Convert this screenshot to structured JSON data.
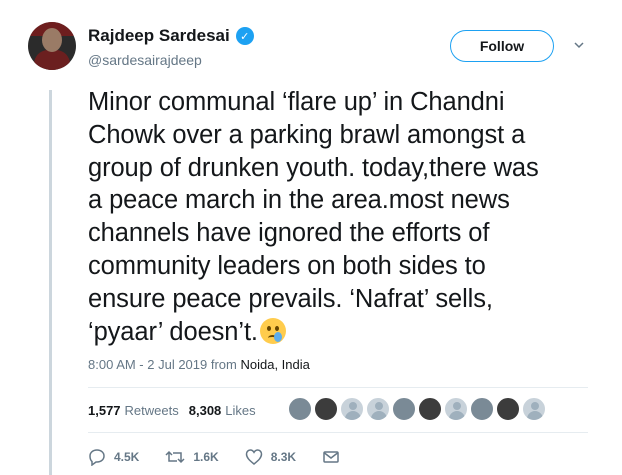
{
  "author": {
    "name": "Rajdeep Sardesai",
    "handle": "@sardesairajdeep",
    "verified_glyph": "✓"
  },
  "follow_label": "Follow",
  "tweet": {
    "text": "Minor communal ‘flare up’ in Chandni\nChowk over a parking brawl amongst a\ngroup of drunken youth. today,there was\na peace march in the area.most news\nchannels have ignored the efforts of\ncommunity leaders on both sides to\nensure peace prevails. ‘Nafrat’ sells,\n‘pyaar’ doesn’t.",
    "emoji": "crying-face-icon"
  },
  "meta": {
    "timestamp": "8:00 AM - 2 Jul 2019 from",
    "location": "Noida, India"
  },
  "stats": {
    "retweets_count": "1,577",
    "retweets_label": "Retweets",
    "likes_count": "8,308",
    "likes_label": "Likes"
  },
  "actions": {
    "replies": "4.5K",
    "retweets": "1.6K",
    "likes": "8.3K"
  },
  "colors": {
    "accent": "#1da1f2",
    "muted": "#657786",
    "text": "#14171a"
  }
}
